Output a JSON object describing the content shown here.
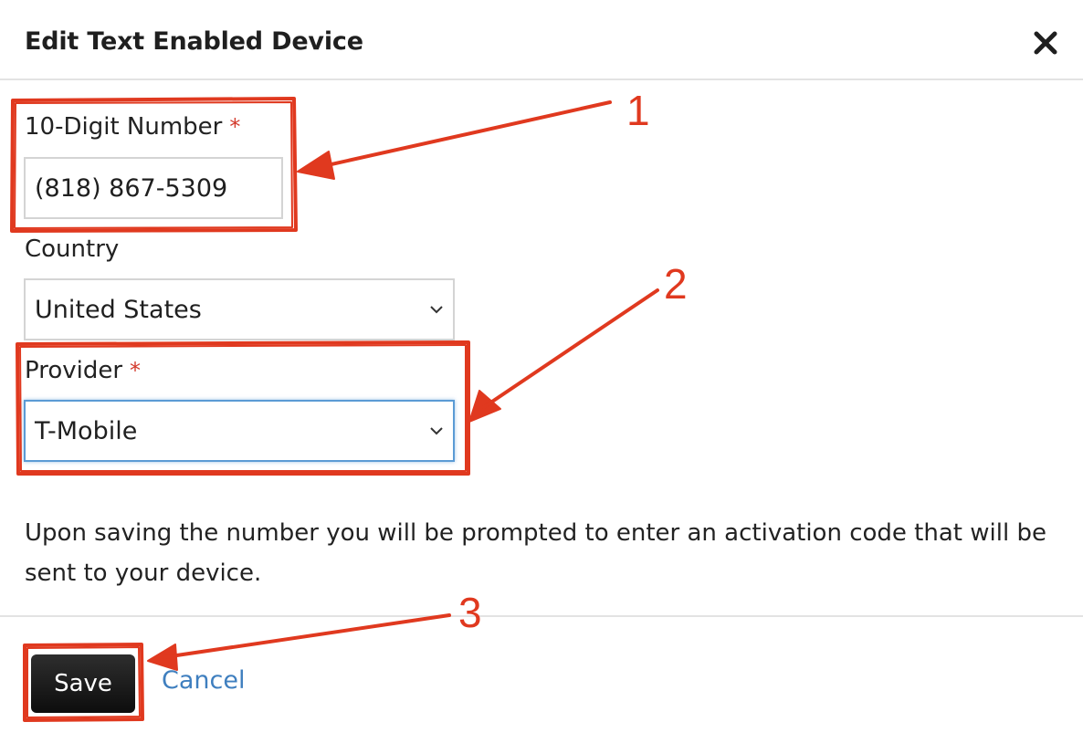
{
  "dialog": {
    "title": "Edit Text Enabled Device",
    "close_icon": "close-icon"
  },
  "form": {
    "number": {
      "label": "10-Digit Number",
      "required_mark": "*",
      "value": "(818) 867-5309"
    },
    "country": {
      "label": "Country",
      "selected": "United States"
    },
    "provider": {
      "label": "Provider",
      "required_mark": "*",
      "selected": "T-Mobile"
    },
    "info_text": "Upon saving the number you will be prompted to enter an activation code that will be sent to your device."
  },
  "footer": {
    "save_label": "Save",
    "cancel_label": "Cancel"
  },
  "annotations": {
    "steps": [
      "1",
      "2",
      "3"
    ],
    "color": "#e0391f"
  },
  "colors": {
    "required": "#d33a2c",
    "link": "#3f7fbf",
    "focus": "#5b9bd5",
    "button": "#111111"
  }
}
